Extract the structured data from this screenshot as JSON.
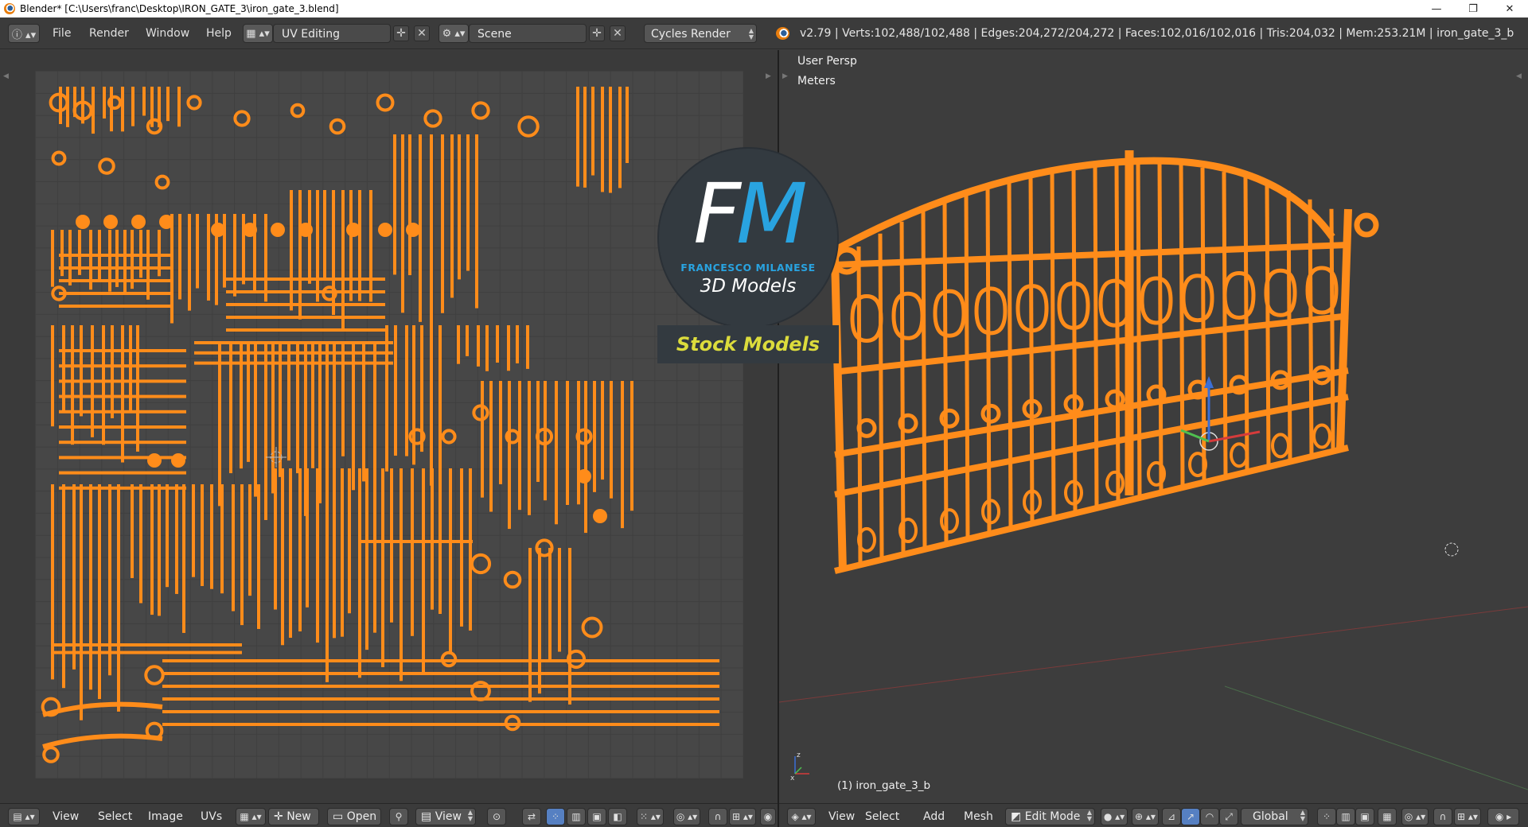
{
  "window": {
    "title": "Blender* [C:\\Users\\franc\\Desktop\\IRON_GATE_3\\iron_gate_3.blend]",
    "minimize_glyph": "—",
    "maximize_glyph": "❐",
    "close_glyph": "✕"
  },
  "info_header": {
    "menus": [
      "File",
      "Render",
      "Window",
      "Help"
    ],
    "screen_layout": "UV Editing",
    "scene": "Scene",
    "render_engine": "Cycles Render",
    "stats": "v2.79 | Verts:102,488/102,488 | Edges:204,272/204,272 | Faces:102,016/102,016 | Tris:204,032 | Mem:253.21M | iron_gate_3_b"
  },
  "view3d": {
    "perspective": "User Persp",
    "units": "Meters",
    "active_object": "(1) iron_gate_3_b"
  },
  "watermark": {
    "letter_1": "F",
    "letter_2": "M",
    "brand": "FRANCESCO MILANESE",
    "subtitle": "3D Models",
    "stock": "Stock Models"
  },
  "uv_header": {
    "menus": [
      "View",
      "Select",
      "Image",
      "UVs"
    ],
    "new_label": "New",
    "open_label": "Open",
    "view_label": "View"
  },
  "view3d_header": {
    "menus": [
      "View",
      "Select",
      "Add",
      "Mesh"
    ],
    "mode": "Edit Mode",
    "orientation": "Global"
  },
  "colors": {
    "mesh": "#ff8c1a",
    "background": "#3d3d3d",
    "uv_grid": "#474747",
    "fm_blue": "#29a3e0",
    "stock_yellow": "#dcdc3c"
  }
}
